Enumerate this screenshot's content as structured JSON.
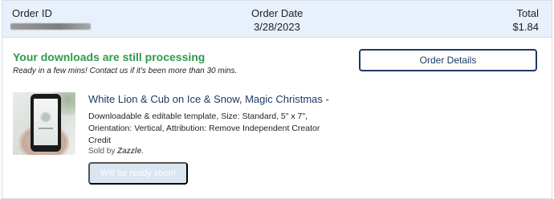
{
  "header": {
    "order_id_label": "Order ID",
    "order_date_label": "Order Date",
    "order_date_value": "3/28/2023",
    "total_label": "Total",
    "total_value": "$1.84"
  },
  "status": {
    "title": "Your downloads are still processing",
    "subtitle": "Ready in a few mins! Contact us if it's been more than 30 mins.",
    "order_details_label": "Order Details"
  },
  "item": {
    "title": "White Lion & Cub on Ice & Snow, Magic Christmas -",
    "description": "Downloadable & editable template, Size: Standard, 5\" x 7\", Orientation: Vertical, Attribution: Remove Independent Creator Credit",
    "sold_by_prefix": "Sold by ",
    "seller": "Zazzle",
    "sold_by_suffix": ".",
    "ready_label": "Will be ready soon!"
  }
}
